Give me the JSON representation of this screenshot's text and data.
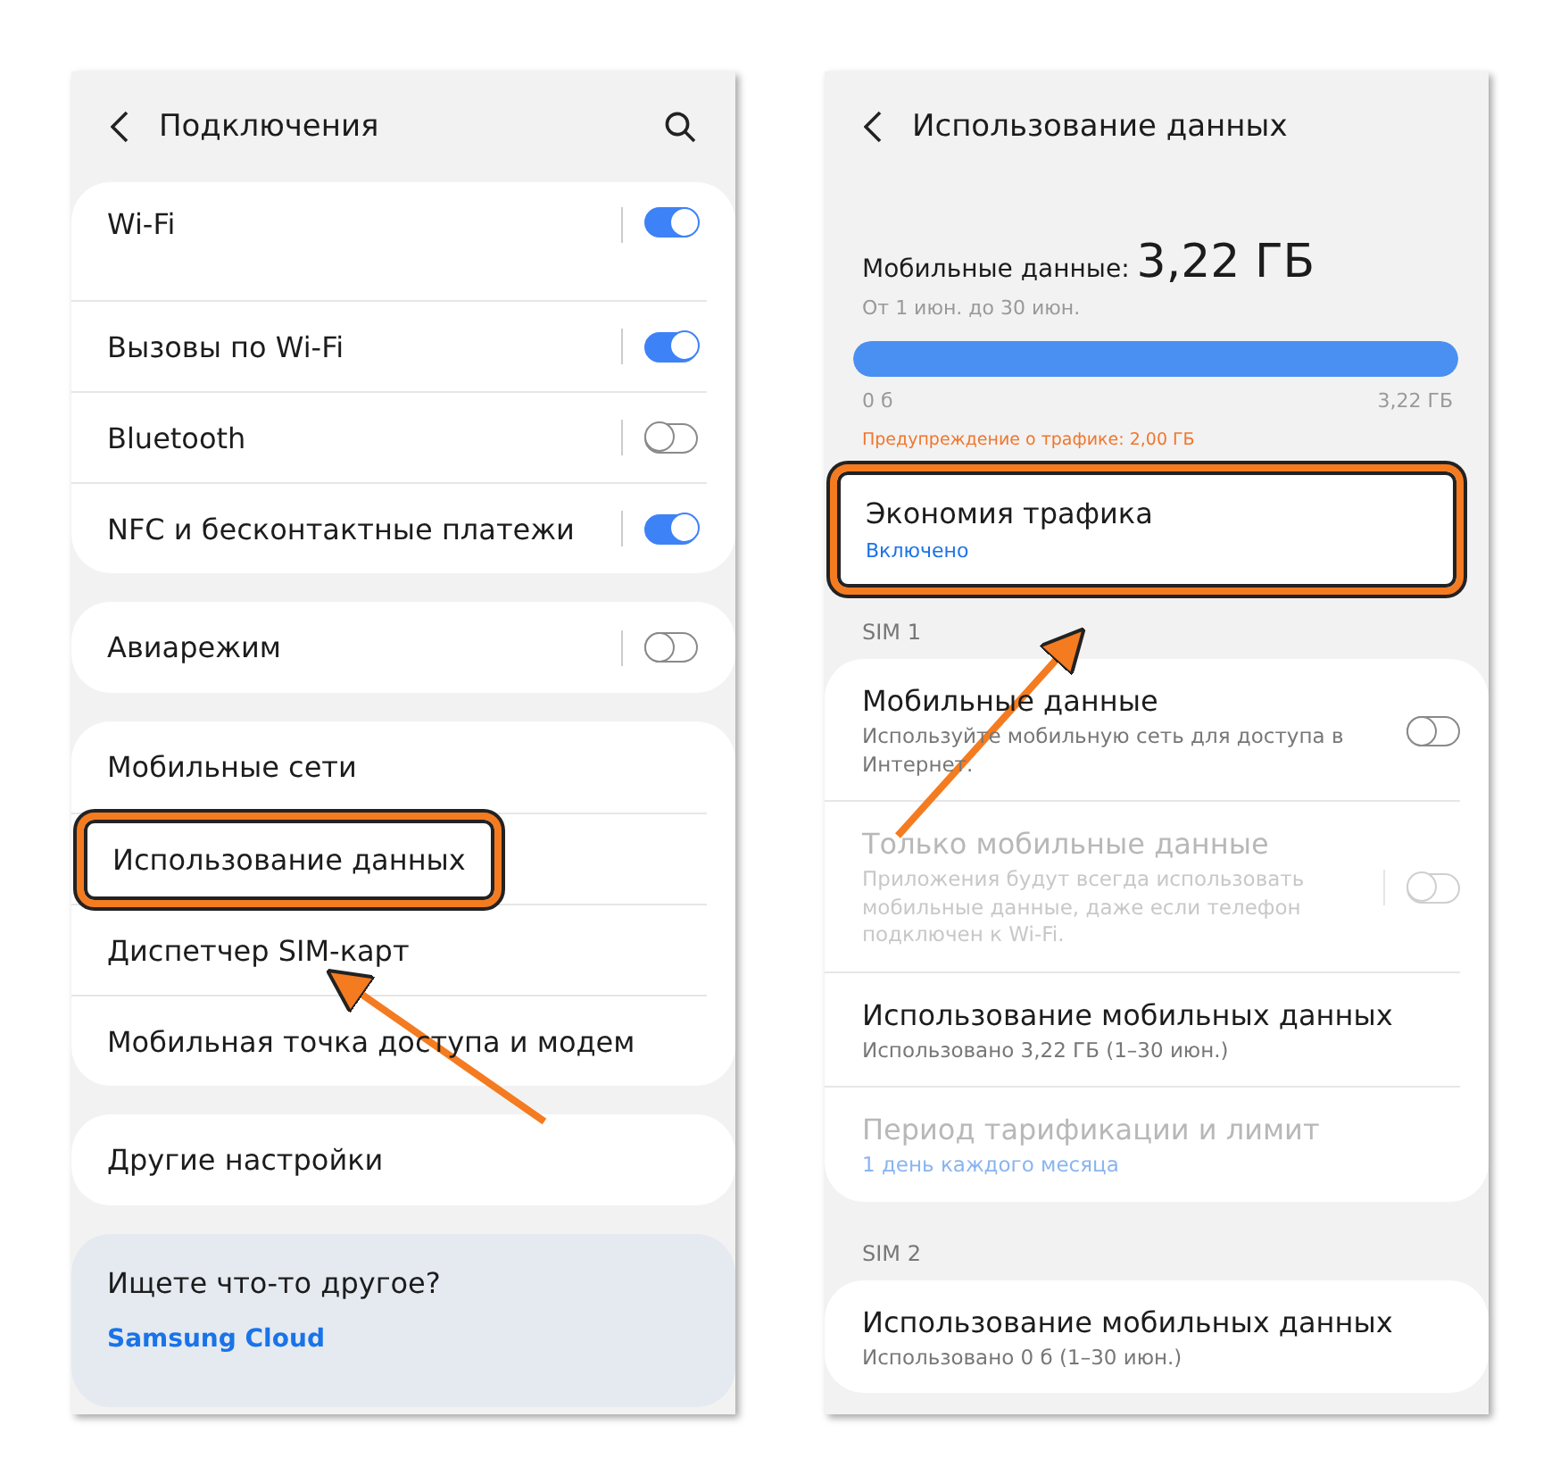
{
  "connections_screen": {
    "title": "Подключения",
    "groups": [
      {
        "kind": "list",
        "items": [
          {
            "label": "Wi-Fi",
            "kind": "toggle",
            "on": true,
            "highlighted": false,
            "tall": true
          },
          {
            "label": "Вызовы по Wi-Fi",
            "kind": "toggle",
            "on": true,
            "highlighted": false
          },
          {
            "label": "Bluetooth",
            "kind": "toggle",
            "on": false,
            "highlighted": false
          },
          {
            "label": "NFC и бесконтактные платежи",
            "kind": "toggle",
            "on": true,
            "highlighted": false
          }
        ]
      },
      {
        "kind": "list",
        "items": [
          {
            "label": "Авиарежим",
            "kind": "toggle",
            "on": false,
            "highlighted": false
          }
        ]
      },
      {
        "kind": "list",
        "items": [
          {
            "label": "Мобильные сети",
            "kind": "link",
            "highlighted": false
          },
          {
            "label": "Использование данных",
            "kind": "link",
            "highlighted": true
          },
          {
            "label": "Диспетчер SIM-карт",
            "kind": "link",
            "highlighted": false
          },
          {
            "label": "Мобильная точка доступа и модем",
            "kind": "link",
            "highlighted": false
          }
        ]
      },
      {
        "kind": "list",
        "items": [
          {
            "label": "Другие настройки",
            "kind": "link",
            "highlighted": false
          }
        ]
      },
      {
        "kind": "suggestion",
        "title": "Ищете что-то другое?",
        "link": "Samsung Cloud"
      }
    ]
  },
  "data_usage_screen": {
    "title": "Использование данных",
    "summary": {
      "label": "Мобильные данные:",
      "amount": "3,22 ГБ",
      "period": "От 1 июн. до 30 июн.",
      "level": 1.0,
      "min": "0 б",
      "max": "3,22 ГБ",
      "warning": "Предупреждение о трафике: 2,00 ГБ"
    },
    "saver": {
      "title": "Экономия трафика",
      "status": "Включено",
      "highlighted": true
    },
    "sections": [
      {
        "header": "SIM 1",
        "items": [
          {
            "title": "Мобильные данные",
            "subtitle": "Используйте мобильную сеть для доступа в Интернет.",
            "kind": "toggle",
            "on": false,
            "disabled": false
          },
          {
            "title": "Только мобильные данные",
            "subtitle": "Приложения будут всегда использовать мобильные данные, даже если телефон подключен к Wi-Fi.",
            "kind": "toggle",
            "on": false,
            "disabled": true
          },
          {
            "title": "Использование мобильных данных",
            "subtitle": "Использовано 3,22 ГБ (1–30 июн.)",
            "kind": "link",
            "disabled": false
          },
          {
            "title": "Период тарификации и лимит",
            "subtitle": "1 день каждого месяца",
            "kind": "link",
            "disabled": true
          }
        ]
      },
      {
        "header": "SIM 2",
        "items": [
          {
            "title": "Использование мобильных данных",
            "subtitle": "Использовано 0 б (1–30 июн.)",
            "kind": "link",
            "disabled": false
          }
        ]
      }
    ]
  }
}
